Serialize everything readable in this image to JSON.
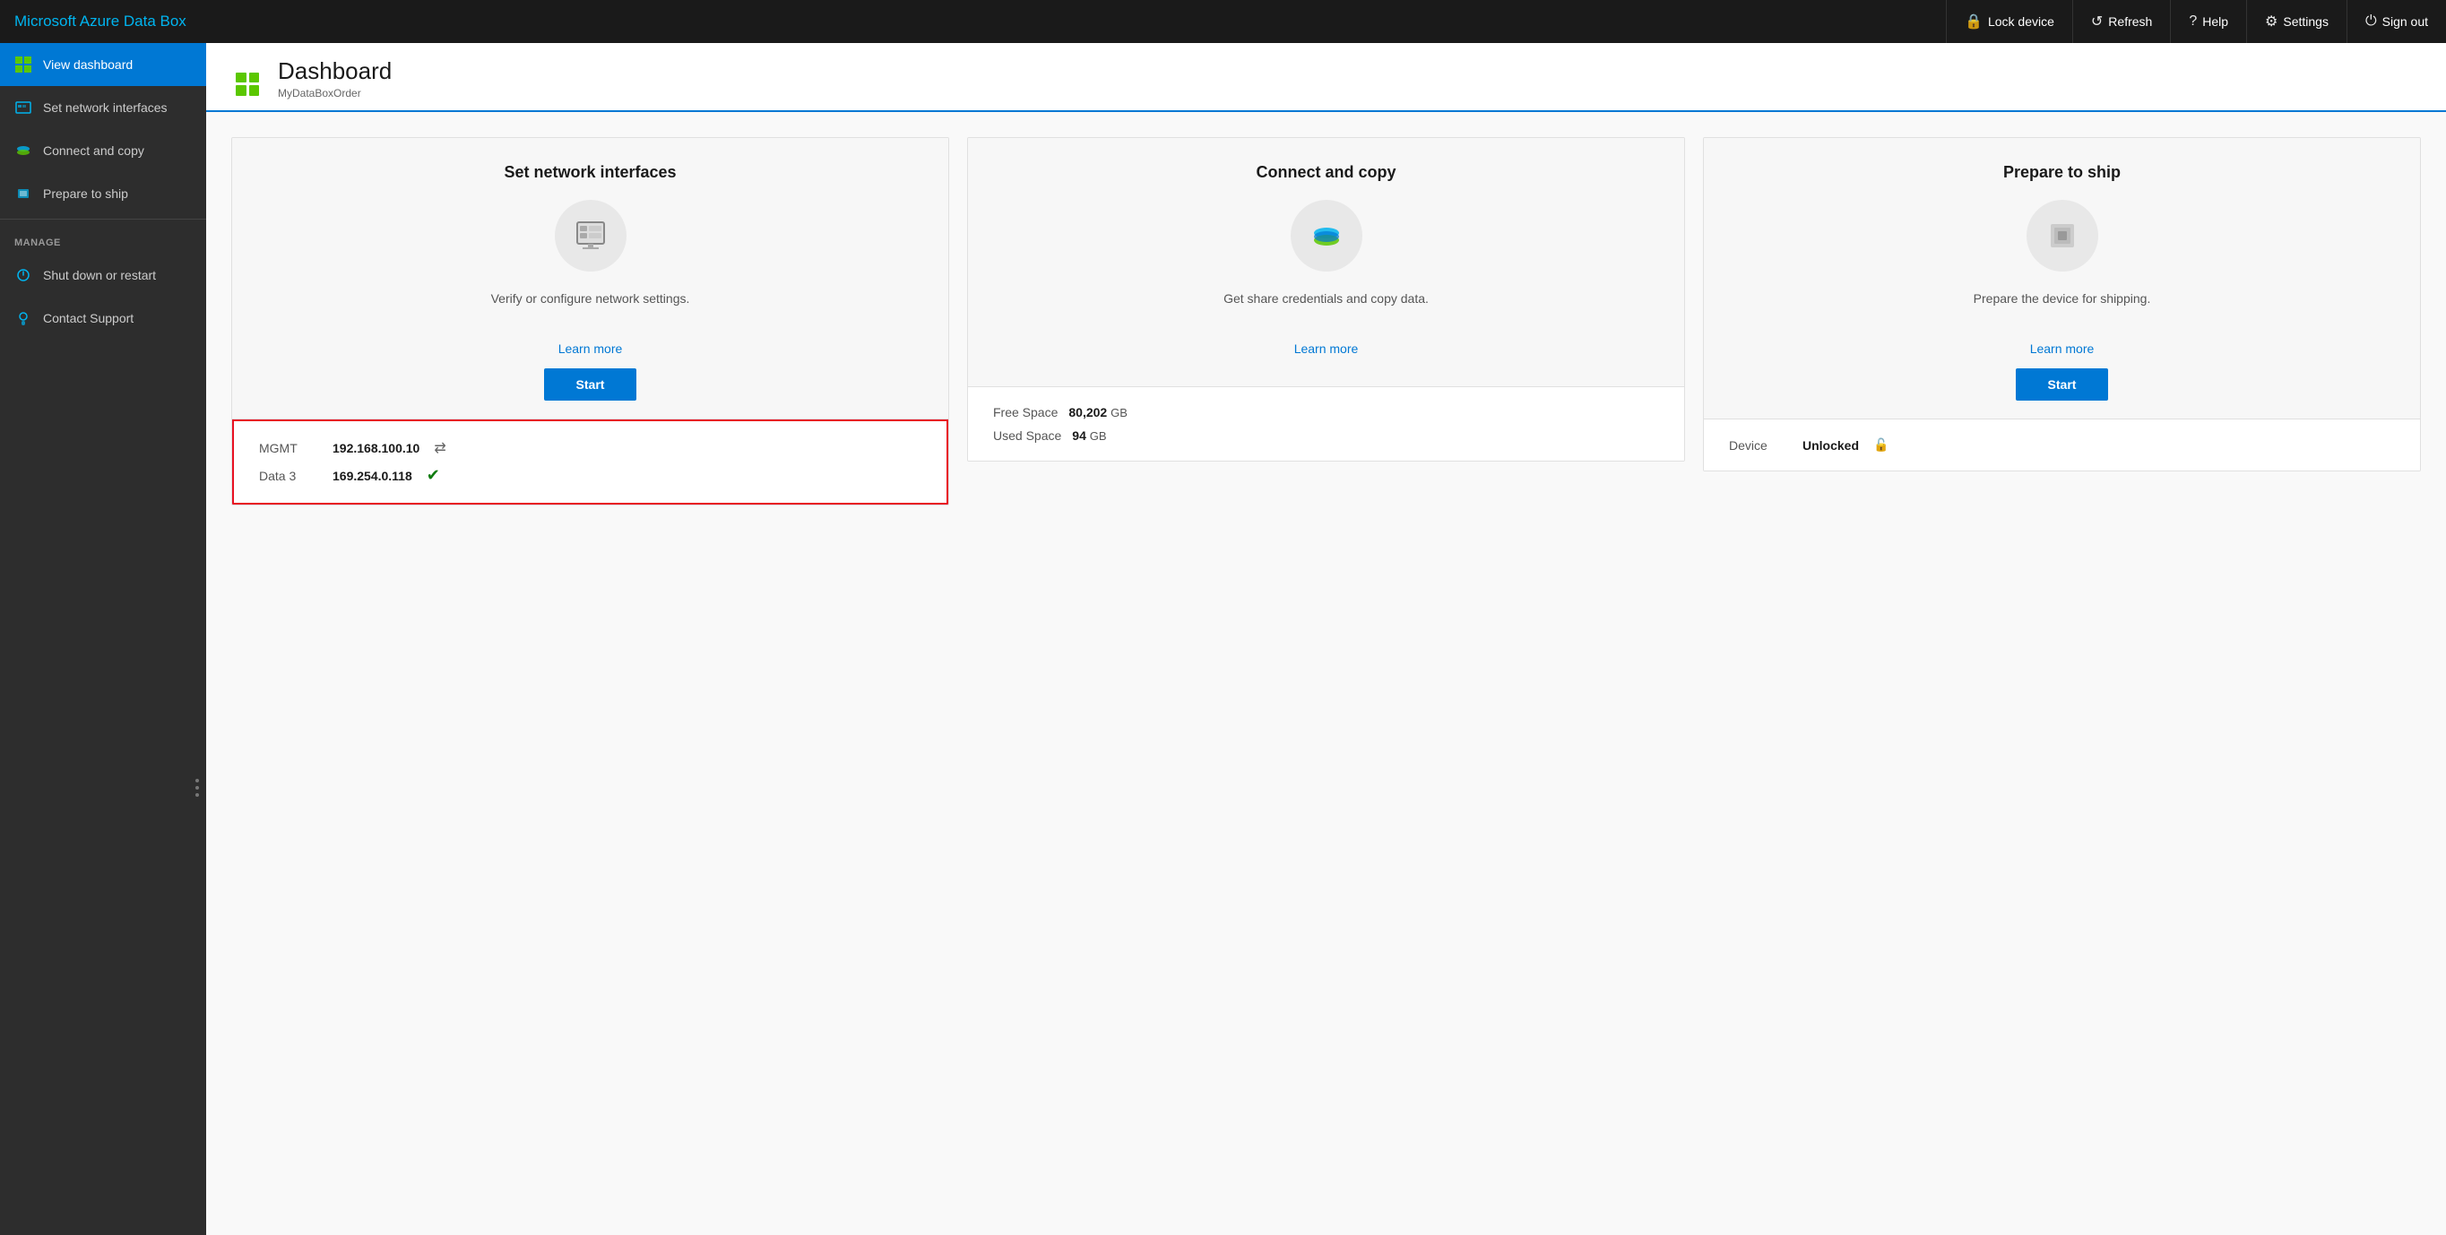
{
  "app": {
    "title": "Microsoft Azure Data Box"
  },
  "topbar": {
    "actions": [
      {
        "id": "lock-device",
        "label": "Lock device",
        "icon": "🔒"
      },
      {
        "id": "refresh",
        "label": "Refresh",
        "icon": "↺"
      },
      {
        "id": "help",
        "label": "Help",
        "icon": "?"
      },
      {
        "id": "settings",
        "label": "Settings",
        "icon": "⚙"
      },
      {
        "id": "sign-out",
        "label": "Sign out",
        "icon": "⏻"
      }
    ]
  },
  "sidebar": {
    "main_items": [
      {
        "id": "dashboard",
        "label": "View dashboard",
        "active": true
      },
      {
        "id": "network",
        "label": "Set network interfaces",
        "active": false
      },
      {
        "id": "copy",
        "label": "Connect and copy",
        "active": false
      },
      {
        "id": "ship",
        "label": "Prepare to ship",
        "active": false
      }
    ],
    "manage_section_label": "MANAGE",
    "manage_items": [
      {
        "id": "shutdown",
        "label": "Shut down or restart",
        "active": false
      },
      {
        "id": "support",
        "label": "Contact Support",
        "active": false
      }
    ]
  },
  "page": {
    "title": "Dashboard",
    "subtitle": "MyDataBoxOrder"
  },
  "cards": [
    {
      "id": "network",
      "title": "Set network interfaces",
      "description": "Verify or configure network settings.",
      "learn_more_label": "Learn more",
      "start_label": "Start",
      "highlighted": true,
      "info_rows": [
        {
          "label": "MGMT",
          "value": "192.168.100.10",
          "status": "link",
          "status_icon": "↔"
        },
        {
          "label": "Data 3",
          "value": "169.254.0.118",
          "status": "ok",
          "status_icon": "✔"
        }
      ]
    },
    {
      "id": "copy",
      "title": "Connect and copy",
      "description": "Get share credentials and copy data.",
      "learn_more_label": "Learn more",
      "start_label": null,
      "highlighted": false,
      "info_rows": [
        {
          "label": "Free Space",
          "value": "80,202",
          "unit": "GB",
          "status": null
        },
        {
          "label": "Used Space",
          "value": "94",
          "unit": "GB",
          "status": null
        }
      ]
    },
    {
      "id": "ship",
      "title": "Prepare to ship",
      "description": "Prepare the device for shipping.",
      "learn_more_label": "Learn more",
      "start_label": "Start",
      "highlighted": false,
      "info_rows": [
        {
          "label": "Device",
          "value": "Unlocked",
          "status": "unlock",
          "status_icon": "🔓"
        }
      ]
    }
  ]
}
